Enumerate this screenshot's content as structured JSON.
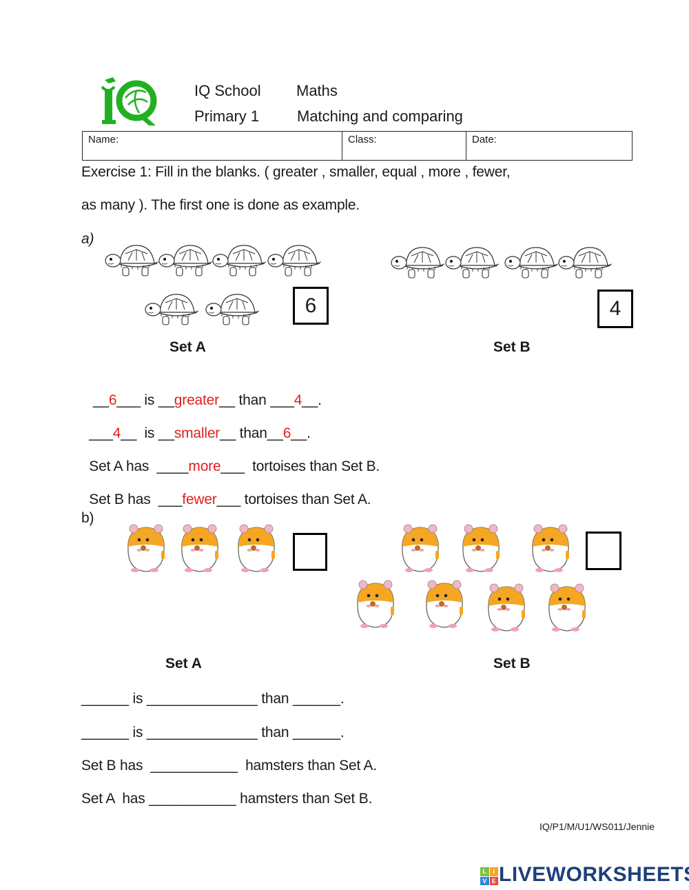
{
  "header": {
    "logo_text": "IQ",
    "school": "IQ School",
    "subject": "Maths",
    "level": "Primary 1",
    "topic": "Matching and comparing"
  },
  "info_table": {
    "name_label": "Name:",
    "class_label": "Class:",
    "date_label": "Date:"
  },
  "instructions": {
    "line1": "Exercise 1: Fill in the blanks. ( greater , smaller, equal , more , fewer,",
    "line2": "as many ). The first one is done as example."
  },
  "part_a": {
    "label": "a)",
    "set_a": {
      "label": "Set A",
      "count": "6",
      "item": "tortoise-icon"
    },
    "set_b": {
      "label": "Set B",
      "count": "4",
      "item": "tortoise-icon"
    },
    "sentences": [
      {
        "pre": " __",
        "v1": "6",
        "mid1": "___ is __",
        "v2": "greater",
        "mid2": "__ than ___",
        "v3": "4",
        "post": "__."
      },
      {
        "pre": "___",
        "v1": "4",
        "mid1": "__  is __",
        "v2": "smaller",
        "mid2": "__ than__",
        "v3": "6",
        "post": "__."
      },
      {
        "pre": "Set A has  ____",
        "v1": "more",
        "post": "___  tortoises than Set B."
      },
      {
        "pre": "Set B has  ___",
        "v1": "fewer",
        "post": "___ tortoises than Set A."
      }
    ]
  },
  "part_b": {
    "label": "b)",
    "set_a": {
      "label": "Set A",
      "count": "",
      "item": "hamster-icon"
    },
    "set_b": {
      "label": "Set B",
      "count": "",
      "item": "hamster-icon"
    },
    "sentences": [
      "______ is ______________ than ______.",
      "______ is ______________ than ______.",
      "Set B has  ___________  hamsters than Set A.",
      "Set A  has ___________ hamsters than Set B."
    ]
  },
  "footer": {
    "code": "IQ/P1/M/U1/WS011/Jennie",
    "brand": "LIVEWORKSHEETS",
    "brand_icon_letters": [
      "L",
      "I",
      "V",
      "E"
    ]
  },
  "colors": {
    "answer": "#e02020",
    "logo_green": "#22b022",
    "brand_blue": "#1d3f7a",
    "hamster_orange": "#f5a623"
  }
}
